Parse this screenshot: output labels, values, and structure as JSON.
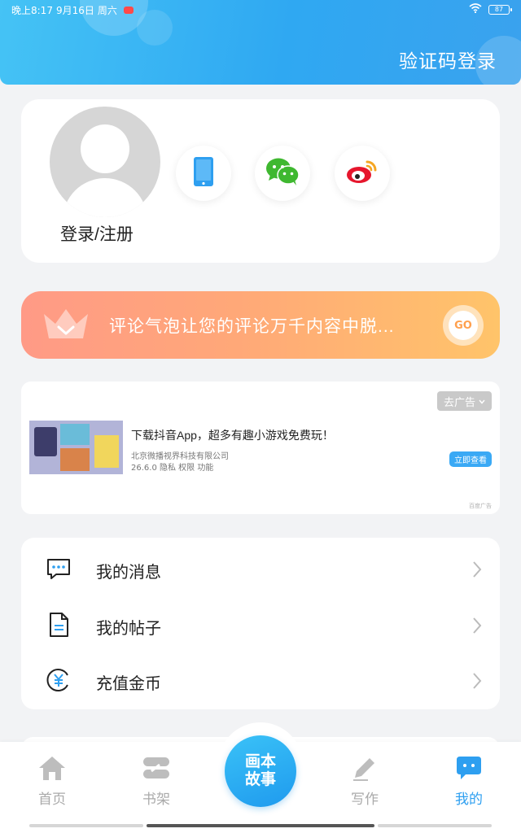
{
  "status_bar": {
    "time": "晚上8:17",
    "date": "9月16日",
    "weekday": "周六",
    "battery": "87"
  },
  "header": {
    "code_login": "验证码登录",
    "colors": {
      "gradient_start": "#45c3f5",
      "gradient_end": "#3aa2ee"
    }
  },
  "login": {
    "label": "登录/注册",
    "social_icons": [
      "phone-icon",
      "wechat-icon",
      "weibo-icon"
    ]
  },
  "promo": {
    "text": "评论气泡让您的评论万千内容中脱...",
    "go_label": "GO"
  },
  "ad": {
    "close_label": "去广告",
    "title": "下载抖音App，超多有趣小游戏免费玩！",
    "company": "北京微播视界科技有限公司",
    "meta": "26.6.0  隐私  权限  功能",
    "view_label": "立即查看",
    "tag": "百度广告"
  },
  "menu": {
    "items": [
      {
        "label": "我的消息",
        "icon": "message-icon"
      },
      {
        "label": "我的帖子",
        "icon": "document-icon"
      },
      {
        "label": "充值金币",
        "icon": "coin-icon"
      }
    ]
  },
  "tabbar": {
    "tabs": [
      {
        "label": "首页",
        "icon": "home-icon"
      },
      {
        "label": "书架",
        "icon": "bookshelf-icon"
      },
      {
        "label": "写作",
        "icon": "pen-icon"
      },
      {
        "label": "我的",
        "icon": "mine-icon",
        "active": true
      }
    ],
    "center_line1": "画本",
    "center_line2": "故事",
    "active_color": "#2e9ff0"
  }
}
